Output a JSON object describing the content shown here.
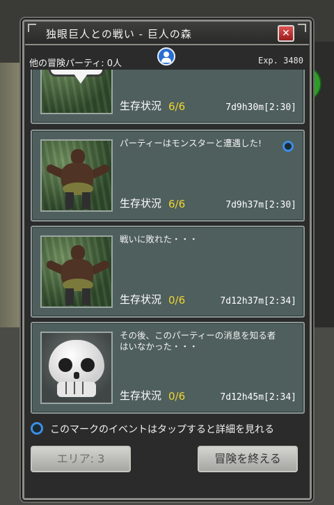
{
  "window": {
    "title": "独眼巨人との戦い - 巨人の森"
  },
  "info": {
    "party_count_label": "他の冒険パーティ: 0人",
    "exp": "Exp. 3480"
  },
  "cards": [
    {
      "message": "",
      "survival_label": "生存状況",
      "survival_value": "6/6",
      "time": "7d9h30m[2:30]"
    },
    {
      "message": "パーティーはモンスターと遭遇した!",
      "survival_label": "生存状況",
      "survival_value": "6/6",
      "time": "7d9h37m[2:30]"
    },
    {
      "message": "戦いに敗れた・・・",
      "survival_label": "生存状況",
      "survival_value": "0/6",
      "time": "7d12h37m[2:34]"
    },
    {
      "message": "その後、このパーティーの消息を知る者はいなかった・・・",
      "survival_label": "生存状況",
      "survival_value": "0/6",
      "time": "7d12h45m[2:34]"
    }
  ],
  "legend": {
    "text": "このマークのイベントはタップすると詳細を見れる"
  },
  "buttons": {
    "area": "エリア: 3",
    "end_adventure": "冒険を終える"
  },
  "colors": {
    "card_bg": "#4f5f5d",
    "survival_value": "#f0d630",
    "detail_mark": "#3b8ee8",
    "close_button": "#c83030"
  }
}
